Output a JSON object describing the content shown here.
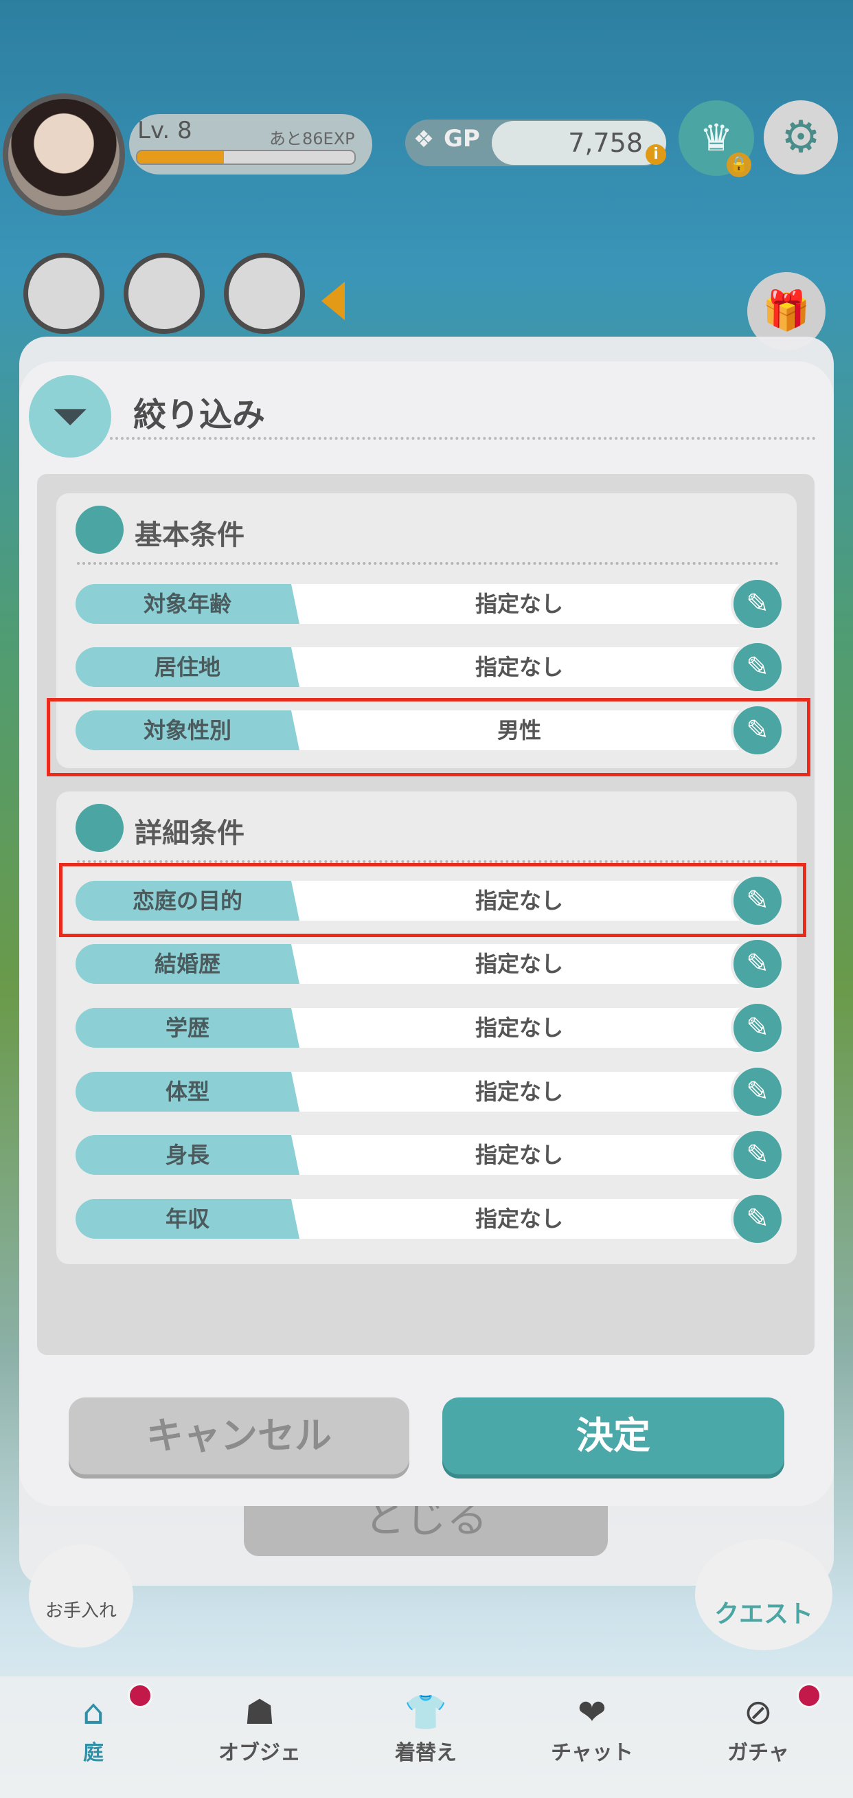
{
  "hud": {
    "level": "Lv. 8",
    "exp_remaining": "あと86EXP",
    "exp_progress": 0.4,
    "gp_label": "GP",
    "gp_value": "7,758"
  },
  "back": {
    "close_label": "とじる",
    "care_label": "お手入れ",
    "quest_label": "クエスト"
  },
  "modal": {
    "title": "絞り込み",
    "sections": [
      {
        "title": "基本条件",
        "rows": [
          {
            "label": "対象年齢",
            "value": "指定なし"
          },
          {
            "label": "居住地",
            "value": "指定なし"
          },
          {
            "label": "対象性別",
            "value": "男性"
          }
        ]
      },
      {
        "title": "詳細条件",
        "rows": [
          {
            "label": "恋庭の目的",
            "value": "指定なし"
          },
          {
            "label": "結婚歴",
            "value": "指定なし"
          },
          {
            "label": "学歴",
            "value": "指定なし"
          },
          {
            "label": "体型",
            "value": "指定なし"
          },
          {
            "label": "身長",
            "value": "指定なし"
          },
          {
            "label": "年収",
            "value": "指定なし"
          }
        ]
      }
    ],
    "cancel_label": "キャンセル",
    "confirm_label": "決定"
  },
  "nav": {
    "items": [
      {
        "label": "庭",
        "icon": "house-icon"
      },
      {
        "label": "オブジェ",
        "icon": "object-icon"
      },
      {
        "label": "着替え",
        "icon": "clothes-icon"
      },
      {
        "label": "チャット",
        "icon": "chat-icon"
      },
      {
        "label": "ガチャ",
        "icon": "gacha-icon"
      }
    ]
  },
  "colors": {
    "accent": "#4aa5a3",
    "label_bg": "#8ccfd4",
    "highlight": "#ea2b1b",
    "badge": "#c2184a"
  }
}
